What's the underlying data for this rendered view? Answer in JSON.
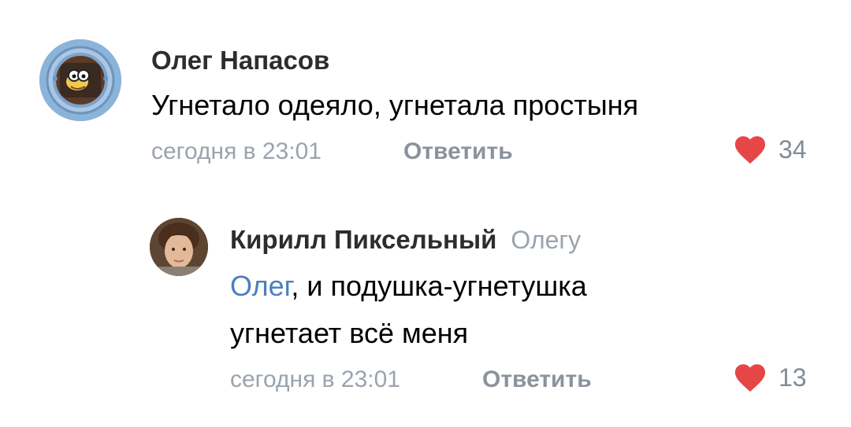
{
  "comments": [
    {
      "author": "Олег Напасов",
      "text": "Угнетало одеяло, угнетала простыня",
      "time": "сегодня в 23:01",
      "reply_label": "Ответить",
      "likes": "34"
    },
    {
      "author": "Кирилл Пиксельный",
      "reply_to": "Олегу",
      "mention": "Олег",
      "text_line1_rest": ", и подушка-угнетушка",
      "text_line2": "угнетает всё меня",
      "time": "сегодня в 23:01",
      "reply_label": "Ответить",
      "likes": "13"
    }
  ],
  "colors": {
    "like_heart": "#e64646",
    "link": "#4a7fbf",
    "secondary_text": "#9aa3ad"
  }
}
